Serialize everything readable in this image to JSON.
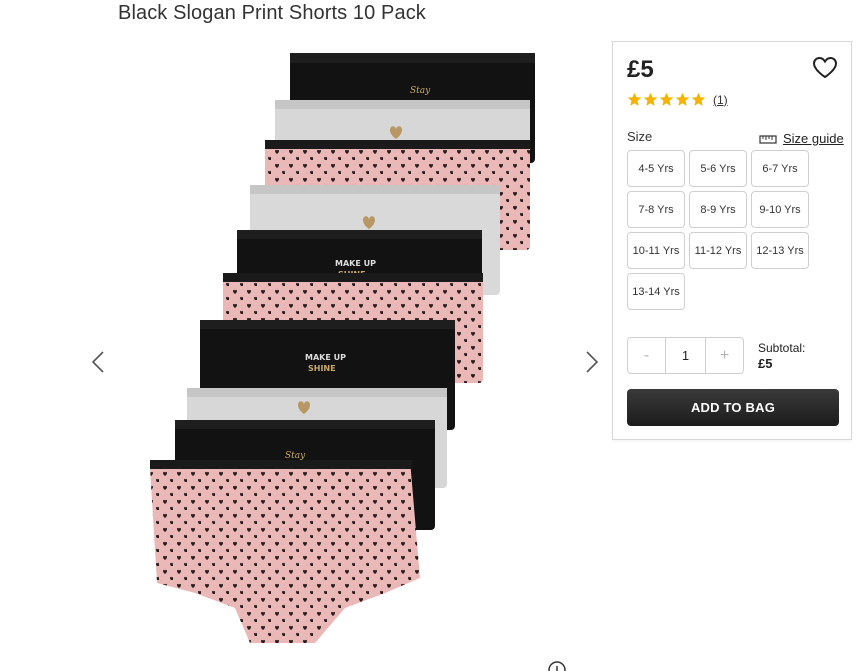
{
  "product": {
    "title": "Black Slogan Print Shorts 10 Pack",
    "price": "£5",
    "rating": 5,
    "review_count": "(1)"
  },
  "size": {
    "label": "Size",
    "guide_label": "Size guide",
    "options": [
      "4-5 Yrs",
      "5-6 Yrs",
      "6-7 Yrs",
      "7-8 Yrs",
      "8-9 Yrs",
      "9-10 Yrs",
      "10-11 Yrs",
      "11-12 Yrs",
      "12-13 Yrs",
      "13-14 Yrs"
    ]
  },
  "quantity": {
    "minus": "-",
    "value": "1",
    "plus": "+"
  },
  "subtotal": {
    "label": "Subtotal:",
    "value": "£5"
  },
  "add_to_bag_label": "ADD TO BAG",
  "colors": {
    "star": "#f5b301",
    "button": "#222222",
    "pink": "#e9b8b7",
    "grey": "#d6d6d6",
    "black": "#111111"
  },
  "icons": {
    "prev": "chevron-left-icon",
    "next": "chevron-right-icon",
    "wishlist": "heart-icon",
    "size_guide": "ruler-icon",
    "zoom": "zoom-icon"
  }
}
